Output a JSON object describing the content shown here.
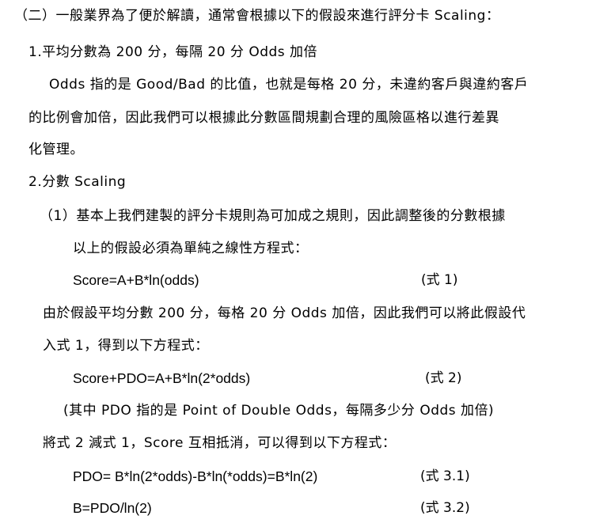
{
  "doc": {
    "section_heading": "（二）一般業界為了便於解讀，通常會根據以下的假設來進行評分卡 Scaling：",
    "item1_heading": "1.平均分數為 200 分，每隔 20 分 Odds 加倍",
    "item1_para_line1": "Odds 指的是 Good/Bad 的比值，也就是每格 20 分，未違約客戶與違約客戶",
    "item1_para_line2": "的比例會加倍，因此我們可以根據此分數區間規劃合理的風險區格以進行差異",
    "item1_para_line3": "化管理。",
    "item2_heading": "2.分數 Scaling",
    "sub1_line1": "（1）基本上我們建製的評分卡規則為可加成之規則，因此調整後的分數根據",
    "sub1_line2": "以上的假設必須為單純之線性方程式：",
    "eq1": "Score=A+B*ln(odds)",
    "eq1_no": "(式 1)",
    "para2_line1": "由於假設平均分數 200 分，每格 20 分 Odds 加倍，因此我們可以將此假設代",
    "para2_line2": "入式 1，得到以下方程式：",
    "eq2": "Score+PDO=A+B*ln(2*odds)",
    "eq2_no": "(式 2)",
    "pdo_note": "(其中 PDO 指的是 Point of Double Odds，每隔多少分 Odds 加倍)",
    "para3": "將式 2 減式 1，Score 互相抵消，可以得到以下方程式：",
    "eq31": "PDO= B*ln(2*odds)-B*ln(*odds)=B*ln(2)",
    "eq31_no": "(式 3.1)",
    "eq32": "B=PDO/ln(2)",
    "eq32_no": "(式 3.2)"
  }
}
